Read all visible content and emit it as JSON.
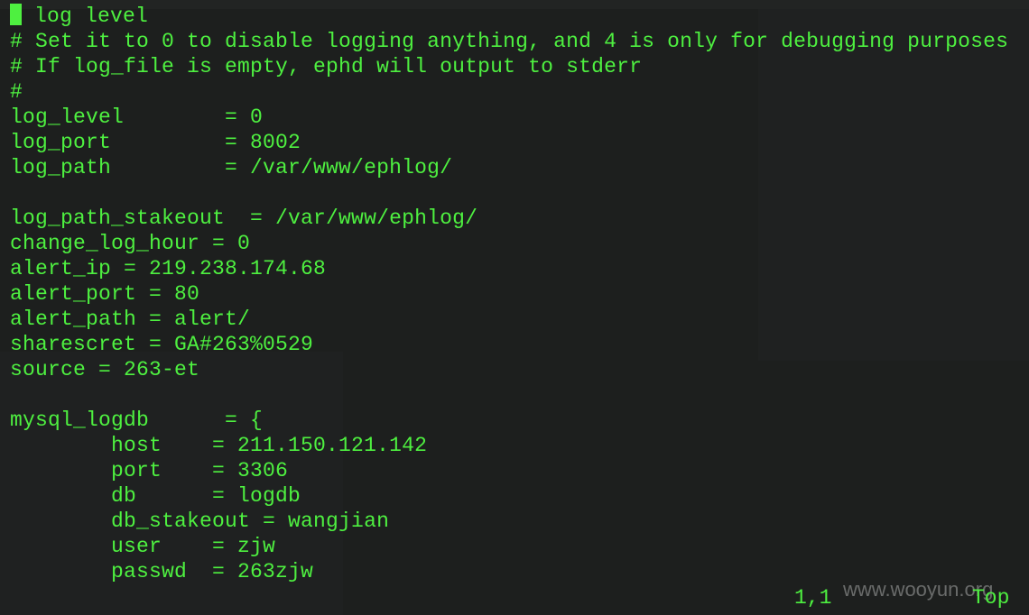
{
  "editor": {
    "lines": [
      " log level",
      "# Set it to 0 to disable logging anything, and 4 is only for debugging purposes",
      "# If log_file is empty, ephd will output to stderr",
      "#",
      "log_level        = 0",
      "log_port         = 8002",
      "log_path         = /var/www/ephlog/",
      "",
      "log_path_stakeout  = /var/www/ephlog/",
      "change_log_hour = 0",
      "alert_ip = 219.238.174.68",
      "alert_port = 80",
      "alert_path = alert/",
      "sharescret = GA#263%0529",
      "source = 263-et",
      "",
      "mysql_logdb      = {",
      "        host    = 211.150.121.142",
      "        port    = 3306",
      "        db      = logdb",
      "        db_stakeout = wangjian",
      "        user    = zjw",
      "        passwd  = 263zjw"
    ]
  },
  "status_bar": {
    "cursor_position": "1,1",
    "scroll_position": "Top"
  },
  "watermark": "www.wooyun.org",
  "colors": {
    "background": "#1d1f1e",
    "text": "#4ef040",
    "cursor": "#4ef040"
  }
}
